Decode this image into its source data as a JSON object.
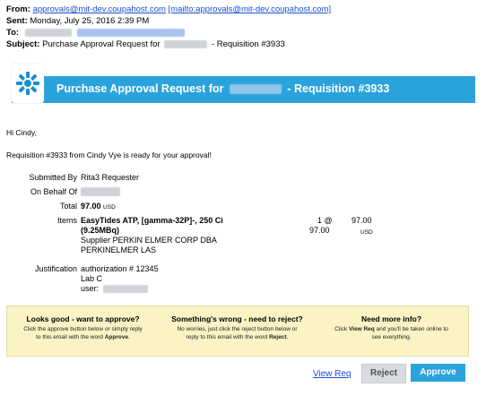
{
  "email": {
    "from_label": "From:",
    "from_address": "approvals@mit-dev.coupahost.com",
    "from_mailto": "[mailto:approvals@mit-dev.coupahost.com]",
    "sent_label": "Sent:",
    "sent_value": "Monday, July 25, 2016 2:39 PM",
    "to_label": "To:",
    "subject_label": "Subject:",
    "subject_prefix": "Purchase Approval Request for",
    "subject_suffix": "- Requisition #3933"
  },
  "banner": {
    "title_prefix": "Purchase Approval Request for",
    "title_suffix": "- Requisition #3933",
    "color": "#2aa3dc"
  },
  "body": {
    "greeting": "Hi Cindy,",
    "intro": "Requisition #3933 from Cindy Vye is ready for your approval!"
  },
  "details": {
    "submitted_by_label": "Submitted By",
    "submitted_by_value": "Rita3 Requester",
    "on_behalf_label": "On Behalf Of",
    "total_label": "Total",
    "total_value": "97.00",
    "currency": "USD",
    "items_label": "Items",
    "item_name_line1": "EasyTides ATP, [gamma-32P]-, 250 Ci",
    "item_name_line2": "(9.25MBq)",
    "item_supplier_line1": "Supplier PERKIN ELMER CORP DBA",
    "item_supplier_line2": "PERKINELMER LAS",
    "item_qty": "1 @",
    "item_unit_price": "97.00",
    "item_total": "97.00",
    "item_currency": "USD",
    "justification_label": "Justification",
    "justification_line1": "authorization # 12345",
    "justification_line2": "Lab C",
    "justification_user_label": "user:"
  },
  "info": {
    "approve_title": "Looks good - want to approve?",
    "approve_body_1": "Click the approve button below or simply reply",
    "approve_body_2a": "to this email with the word ",
    "approve_body_2b": "Approve",
    "approve_body_2c": ".",
    "reject_title": "Something's wrong - need to reject?",
    "reject_body_1": "No worries, just click the reject button below or",
    "reject_body_2a": "reply to this email with the word ",
    "reject_body_2b": "Reject",
    "reject_body_2c": ".",
    "more_title": "Need more info?",
    "more_body_1a": "Click ",
    "more_body_1b": "View Req",
    "more_body_1c": " and you'll be taken online to",
    "more_body_2": "see everything."
  },
  "actions": {
    "view_req": "View Req",
    "reject": "Reject",
    "approve": "Approve"
  }
}
